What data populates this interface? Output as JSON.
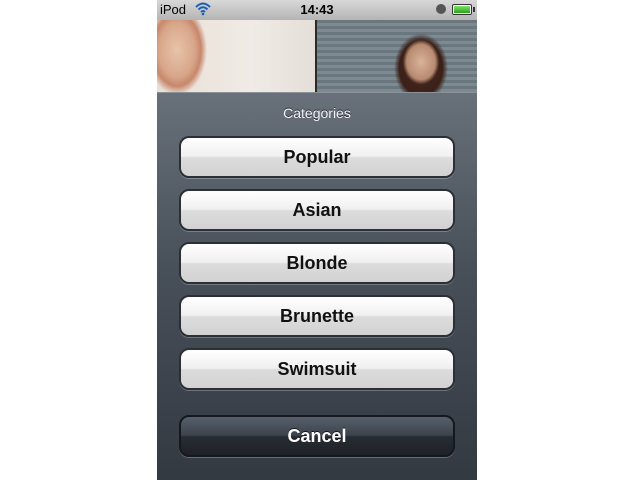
{
  "status_bar": {
    "carrier": "iPod",
    "time": "14:43",
    "icons": [
      "wifi-icon",
      "lock-icon",
      "battery-icon"
    ],
    "battery_level": 1.0
  },
  "action_sheet": {
    "title": "Categories",
    "options": [
      {
        "label": "Popular"
      },
      {
        "label": "Asian"
      },
      {
        "label": "Blonde"
      },
      {
        "label": "Brunette"
      },
      {
        "label": "Swimsuit"
      }
    ],
    "cancel_label": "Cancel"
  },
  "colors": {
    "sheet_background": "#4a525c",
    "button_face": "#e8e8e8",
    "cancel_face": "#2c3138"
  }
}
